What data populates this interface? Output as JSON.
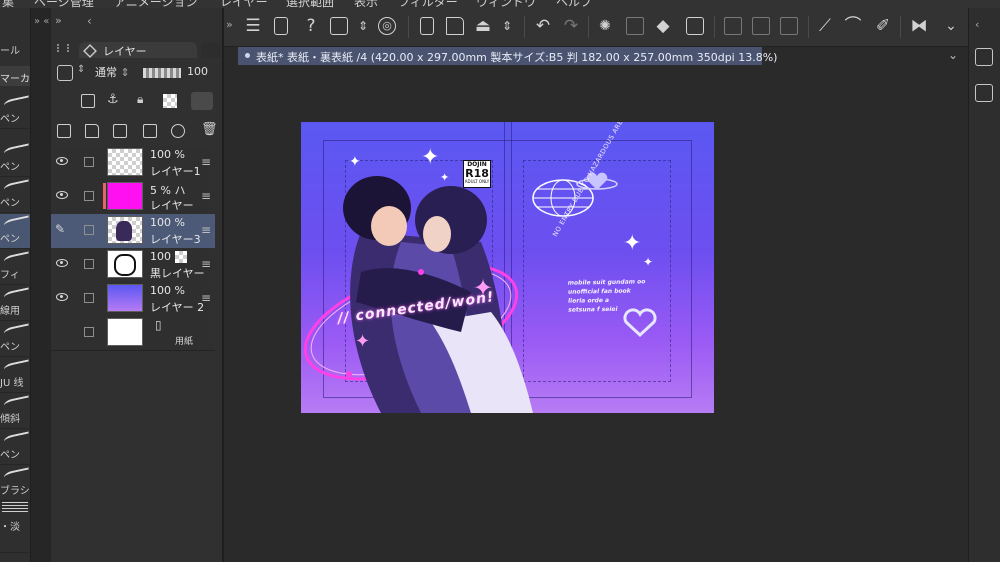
{
  "menubar": {
    "items": [
      "集",
      "ページ管理",
      "アニメーション",
      "レイヤー",
      "選択範囲",
      "表示",
      "フィルター",
      "ウィンドウ",
      "ヘルプ"
    ]
  },
  "toolbox": {
    "sub_title": "ール",
    "tools": [
      {
        "label": "マーカ",
        "selected": false
      },
      {
        "label": "ペン",
        "selected": false
      },
      {
        "label": "ペン",
        "selected": false
      },
      {
        "label": "ペン",
        "selected": false
      },
      {
        "label": "ペン",
        "selected": true
      },
      {
        "label": "フィ",
        "selected": false
      },
      {
        "label": "線用",
        "selected": false
      },
      {
        "label": "ペン",
        "selected": false
      },
      {
        "label": "JU 线",
        "selected": false
      },
      {
        "label": "傾斜",
        "selected": false
      },
      {
        "label": "ペン",
        "selected": false
      },
      {
        "label": "ブラシ",
        "selected": false
      },
      {
        "label": "・淡",
        "selected": false
      }
    ]
  },
  "layer_panel": {
    "collapse": "»",
    "tab_label": "レイヤー",
    "blend_mode": "通常",
    "opacity": "100",
    "layers": [
      {
        "opacity": "100 %",
        "mode": "",
        "name": "レイヤー1",
        "thumb": "checker",
        "thumb_color": "",
        "visible": true,
        "editing": false,
        "swatch": ""
      },
      {
        "opacity": "5 %",
        "mode": "ハ",
        "name": "レイヤー",
        "thumb": "solid",
        "thumb_color": "#ff10f0",
        "visible": true,
        "editing": false,
        "swatch": "#e8646c"
      },
      {
        "opacity": "100 %",
        "mode": "",
        "name": "レイヤー3",
        "thumb": "art",
        "thumb_color": "",
        "visible": false,
        "editing": true,
        "swatch": "",
        "selected": true
      },
      {
        "opacity": "100",
        "mode": "",
        "name": "黒レイヤー",
        "thumb": "lineart",
        "thumb_color": "",
        "visible": true,
        "editing": false,
        "swatch": ""
      },
      {
        "opacity": "100 %",
        "mode": "",
        "name": "レイヤー 2",
        "thumb": "gradient",
        "thumb_color": "",
        "visible": true,
        "editing": false,
        "swatch": ""
      },
      {
        "opacity": "",
        "mode": "",
        "name": "用紙",
        "thumb": "paper",
        "thumb_color": "#ffffff",
        "visible": false,
        "editing": false,
        "swatch": ""
      }
    ]
  },
  "canvas_tab": {
    "title": "表紙* 表紙・裏表紙 /4 (420.00 x 297.00mm 製本サイズ:B5 判 182.00 x 257.00mm 350dpi 13.8%)"
  },
  "artwork": {
    "rating_top": "DOJIN",
    "rating": "R18",
    "rating_note": "ADULT ONLY",
    "front_title": "// connected/won!",
    "back_title": "mobile suit gundam oo\nunofficial fan book\nlieria orde a\nsetsuna f seiei",
    "warning": "NO ENTRY DUE TO HAZARDOUS AREA. FAILURE TO COMPLY WITH WARNINGS WILL RESULT IN DETENTION"
  },
  "colors": {
    "accent_selection": "#4c5a78",
    "art_gradient_top": "#5b58f2",
    "art_gradient_bottom": "#b77bf4",
    "neon": "#ff40e6"
  }
}
